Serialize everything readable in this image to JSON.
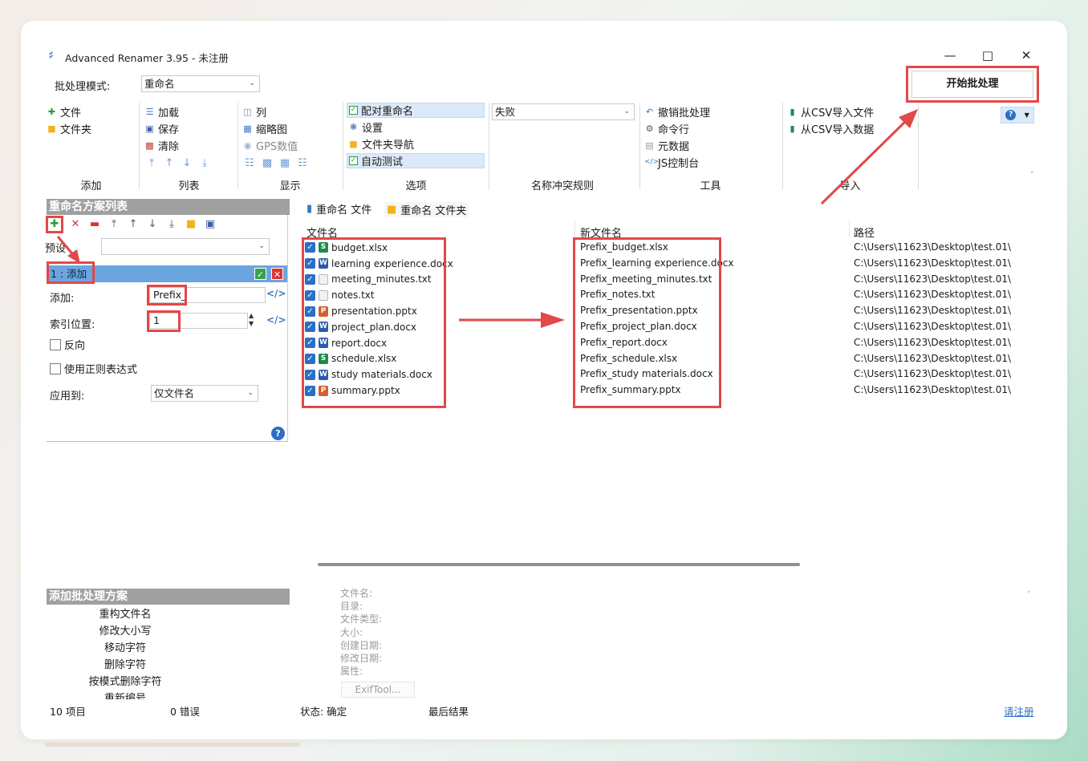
{
  "window": {
    "title": "Advanced Renamer 3.95 - 未注册"
  },
  "batch_mode": {
    "label": "批处理模式:",
    "value": "重命名"
  },
  "start_button": "开始批处理",
  "ribbon": {
    "add": {
      "items": [
        "文件",
        "文件夹"
      ],
      "label": "添加"
    },
    "list": {
      "items": [
        "加载",
        "保存",
        "清除"
      ],
      "label": "列表"
    },
    "display": {
      "items": [
        "列",
        "缩略图",
        "GPS数值"
      ],
      "label": "显示"
    },
    "options": {
      "items": [
        "配对重命名",
        "设置",
        "文件夹导航",
        "自动测试"
      ],
      "label": "选项"
    },
    "conflict": {
      "value": "失败",
      "label": "名称冲突规则"
    },
    "tools": {
      "items": [
        "撤销批处理",
        "命令行",
        "元数据",
        "JS控制台"
      ],
      "label": "工具"
    },
    "import": {
      "items": [
        "从CSV导入文件",
        "从CSV导入数据"
      ],
      "label": "导入"
    }
  },
  "method_panel": {
    "title": "重命名方案列表",
    "preset_label": "预设",
    "step_title": "1 : 添加",
    "add_label": "添加:",
    "add_value": "Prefix_",
    "index_label": "索引位置:",
    "index_value": "1",
    "reverse_label": "反向",
    "regex_label": "使用正则表达式",
    "apply_label": "应用到:",
    "apply_value": "仅文件名"
  },
  "tabs": [
    "重命名 文件",
    "重命名 文件夹"
  ],
  "columns": {
    "filename": "文件名",
    "newname": "新文件名",
    "path": "路径"
  },
  "files": [
    {
      "name": "budget.xlsx",
      "new": "Prefix_budget.xlsx",
      "path": "C:\\Users\\11623\\Desktop\\test.01\\",
      "type": "x"
    },
    {
      "name": "learning experience.docx",
      "new": "Prefix_learning experience.docx",
      "path": "C:\\Users\\11623\\Desktop\\test.01\\",
      "type": "w"
    },
    {
      "name": "meeting_minutes.txt",
      "new": "Prefix_meeting_minutes.txt",
      "path": "C:\\Users\\11623\\Desktop\\test.01\\",
      "type": "t"
    },
    {
      "name": "notes.txt",
      "new": "Prefix_notes.txt",
      "path": "C:\\Users\\11623\\Desktop\\test.01\\",
      "type": "t"
    },
    {
      "name": "presentation.pptx",
      "new": "Prefix_presentation.pptx",
      "path": "C:\\Users\\11623\\Desktop\\test.01\\",
      "type": "p"
    },
    {
      "name": "project_plan.docx",
      "new": "Prefix_project_plan.docx",
      "path": "C:\\Users\\11623\\Desktop\\test.01\\",
      "type": "w"
    },
    {
      "name": "report.docx",
      "new": "Prefix_report.docx",
      "path": "C:\\Users\\11623\\Desktop\\test.01\\",
      "type": "w"
    },
    {
      "name": "schedule.xlsx",
      "new": "Prefix_schedule.xlsx",
      "path": "C:\\Users\\11623\\Desktop\\test.01\\",
      "type": "x"
    },
    {
      "name": "study materials.docx",
      "new": "Prefix_study materials.docx",
      "path": "C:\\Users\\11623\\Desktop\\test.01\\",
      "type": "w"
    },
    {
      "name": "summary.pptx",
      "new": "Prefix_summary.pptx",
      "path": "C:\\Users\\11623\\Desktop\\test.01\\",
      "type": "p"
    }
  ],
  "add_method_panel": {
    "title": "添加批处理方案",
    "items": [
      "重构文件名",
      "修改大小写",
      "移动字符",
      "删除字符",
      "按模式删除字符",
      "重新编号"
    ]
  },
  "file_info": {
    "labels": [
      "文件名:",
      "目录:",
      "文件类型:",
      "大小:",
      "创建日期:",
      "修改日期:",
      "属性:"
    ],
    "exiftool": "ExifTool..."
  },
  "status_bar": {
    "items": "10 项目",
    "errors": "0 错误",
    "status": "状态: 确定",
    "last_result": "最后结果",
    "register": "请注册"
  },
  "colors": {
    "annotation": "#e24848",
    "selection": "#6aa5e0",
    "accent": "#2b6fc4"
  }
}
